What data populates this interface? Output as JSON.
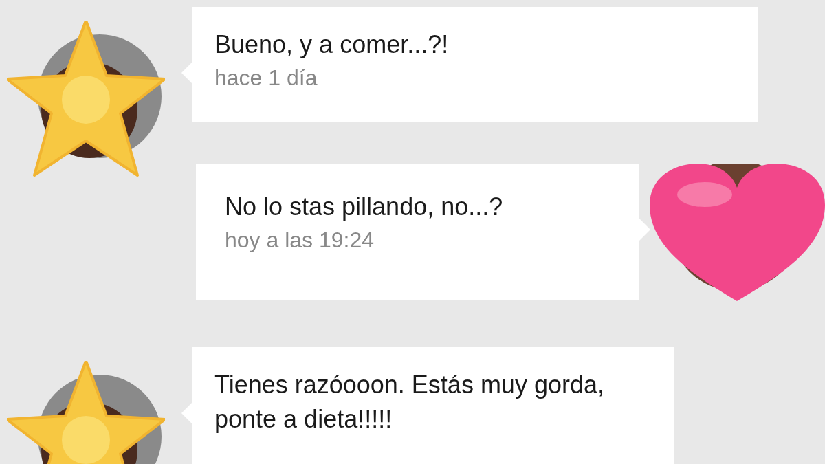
{
  "messages": [
    {
      "kind": "received",
      "text": "Bueno, y a comer...?!",
      "time": "hace 1 día"
    },
    {
      "kind": "sent",
      "text": "No lo stas pillando, no...?",
      "time": "hoy a las 19:24"
    },
    {
      "kind": "received",
      "text": "Tienes razóooon. Estás muy gorda, ponte a dieta!!!!!"
    }
  ]
}
